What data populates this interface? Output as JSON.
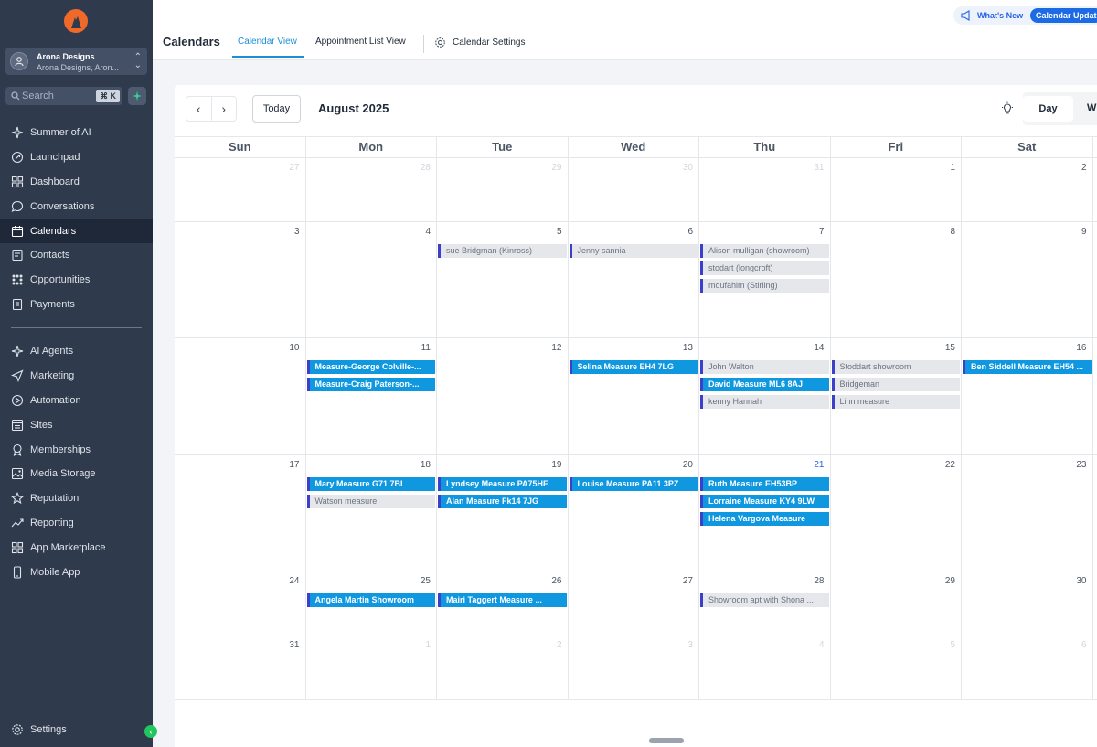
{
  "sidebar": {
    "account": {
      "name": "Arona Designs",
      "sub": "Arona Designs, Aron..."
    },
    "search": {
      "placeholder": "Search",
      "shortcut": "⌘ K"
    },
    "nav_top": [
      {
        "label": "Summer of AI",
        "icon": "sparkle-icon"
      },
      {
        "label": "Launchpad",
        "icon": "rocket-icon"
      },
      {
        "label": "Dashboard",
        "icon": "dashboard-icon"
      },
      {
        "label": "Conversations",
        "icon": "chat-icon"
      },
      {
        "label": "Calendars",
        "icon": "calendar-icon",
        "active": true
      },
      {
        "label": "Contacts",
        "icon": "contacts-icon"
      },
      {
        "label": "Opportunities",
        "icon": "opportunities-icon"
      },
      {
        "label": "Payments",
        "icon": "payments-icon"
      }
    ],
    "nav_bottom": [
      {
        "label": "AI Agents",
        "icon": "sparkle-icon"
      },
      {
        "label": "Marketing",
        "icon": "send-icon"
      },
      {
        "label": "Automation",
        "icon": "automation-icon"
      },
      {
        "label": "Sites",
        "icon": "sites-icon"
      },
      {
        "label": "Memberships",
        "icon": "memberships-icon"
      },
      {
        "label": "Media Storage",
        "icon": "image-icon"
      },
      {
        "label": "Reputation",
        "icon": "star-icon"
      },
      {
        "label": "Reporting",
        "icon": "trend-icon"
      },
      {
        "label": "App Marketplace",
        "icon": "grid-icon"
      },
      {
        "label": "Mobile App",
        "icon": "phone-icon"
      }
    ],
    "settings_label": "Settings"
  },
  "topbar": {
    "whats_new": "What's New",
    "update_badge": "Calendar Updat",
    "title": "Calendars",
    "tabs": [
      "Calendar View",
      "Appointment List View",
      "Calendar Settings"
    ]
  },
  "calendar": {
    "today_label": "Today",
    "month_label": "August 2025",
    "view_day": "Day",
    "view_week": "W",
    "weekdays": [
      "Sun",
      "Mon",
      "Tue",
      "Wed",
      "Thu",
      "Fri",
      "Sat"
    ],
    "weeks": [
      {
        "height": 70,
        "days": [
          {
            "n": "27",
            "muted": true,
            "events": []
          },
          {
            "n": "28",
            "muted": true,
            "events": []
          },
          {
            "n": "29",
            "muted": true,
            "events": []
          },
          {
            "n": "30",
            "muted": true,
            "events": []
          },
          {
            "n": "31",
            "muted": true,
            "events": []
          },
          {
            "n": "1",
            "events": []
          },
          {
            "n": "2",
            "events": []
          }
        ]
      },
      {
        "height": 127,
        "days": [
          {
            "n": "3",
            "events": []
          },
          {
            "n": "4",
            "events": []
          },
          {
            "n": "5",
            "events": [
              {
                "t": "sue Bridgman (Kinross)",
                "c": "g"
              }
            ]
          },
          {
            "n": "6",
            "events": [
              {
                "t": "Jenny sannia",
                "c": "g"
              }
            ]
          },
          {
            "n": "7",
            "events": [
              {
                "t": "Alison mulligan (showroom)",
                "c": "g"
              },
              {
                "t": "stodart (longcroft)",
                "c": "g"
              },
              {
                "t": "moufahim (Stirling)",
                "c": "g"
              }
            ]
          },
          {
            "n": "8",
            "events": []
          },
          {
            "n": "9",
            "events": []
          }
        ]
      },
      {
        "height": 128,
        "days": [
          {
            "n": "10",
            "events": []
          },
          {
            "n": "11",
            "events": [
              {
                "t": "Measure-George Colville-...",
                "c": "b"
              },
              {
                "t": "Measure-Craig Paterson-...",
                "c": "b"
              }
            ]
          },
          {
            "n": "12",
            "events": []
          },
          {
            "n": "13",
            "events": [
              {
                "t": "Selina Measure EH4 7LG",
                "c": "b"
              }
            ]
          },
          {
            "n": "14",
            "events": [
              {
                "t": "John Walton",
                "c": "g"
              },
              {
                "t": "David Measure ML6 8AJ",
                "c": "b"
              },
              {
                "t": "kenny Hannah",
                "c": "g"
              }
            ]
          },
          {
            "n": "15",
            "events": [
              {
                "t": "Stoddart showroom",
                "c": "g"
              },
              {
                "t": "Bridgeman",
                "c": "g"
              },
              {
                "t": "Linn measure",
                "c": "g"
              }
            ]
          },
          {
            "n": "16",
            "events": [
              {
                "t": "Ben Siddell Measure EH54 ...",
                "c": "b"
              }
            ]
          }
        ]
      },
      {
        "height": 127,
        "days": [
          {
            "n": "17",
            "events": []
          },
          {
            "n": "18",
            "events": [
              {
                "t": "Mary Measure G71 7BL",
                "c": "b"
              },
              {
                "t": "Watson measure",
                "c": "g"
              }
            ]
          },
          {
            "n": "19",
            "events": [
              {
                "t": "Lyndsey Measure PA75HE",
                "c": "b"
              },
              {
                "t": "Alan Measure Fk14 7JG",
                "c": "b"
              }
            ]
          },
          {
            "n": "20",
            "events": [
              {
                "t": "Louise Measure PA11 3PZ",
                "c": "b"
              }
            ]
          },
          {
            "n": "21",
            "today": true,
            "events": [
              {
                "t": "Ruth Measure EH53BP",
                "c": "b"
              },
              {
                "t": "Lorraine Measure KY4 9LW",
                "c": "b"
              },
              {
                "t": "Helena Vargova Measure",
                "c": "b"
              }
            ]
          },
          {
            "n": "22",
            "events": []
          },
          {
            "n": "23",
            "events": []
          }
        ]
      },
      {
        "height": 70,
        "days": [
          {
            "n": "24",
            "events": []
          },
          {
            "n": "25",
            "events": [
              {
                "t": "Angela Martin Showroom",
                "c": "b"
              }
            ]
          },
          {
            "n": "26",
            "events": [
              {
                "t": "Mairi Taggert Measure ...",
                "c": "b"
              }
            ]
          },
          {
            "n": "27",
            "events": []
          },
          {
            "n": "28",
            "events": [
              {
                "t": "Showroom apt with Shona ...",
                "c": "g"
              }
            ]
          },
          {
            "n": "29",
            "events": []
          },
          {
            "n": "30",
            "events": []
          }
        ]
      },
      {
        "height": 71,
        "days": [
          {
            "n": "31",
            "events": []
          },
          {
            "n": "1",
            "muted": true,
            "events": []
          },
          {
            "n": "2",
            "muted": true,
            "events": []
          },
          {
            "n": "3",
            "muted": true,
            "events": []
          },
          {
            "n": "4",
            "muted": true,
            "events": []
          },
          {
            "n": "5",
            "muted": true,
            "events": []
          },
          {
            "n": "6",
            "muted": true,
            "events": []
          }
        ]
      }
    ]
  }
}
